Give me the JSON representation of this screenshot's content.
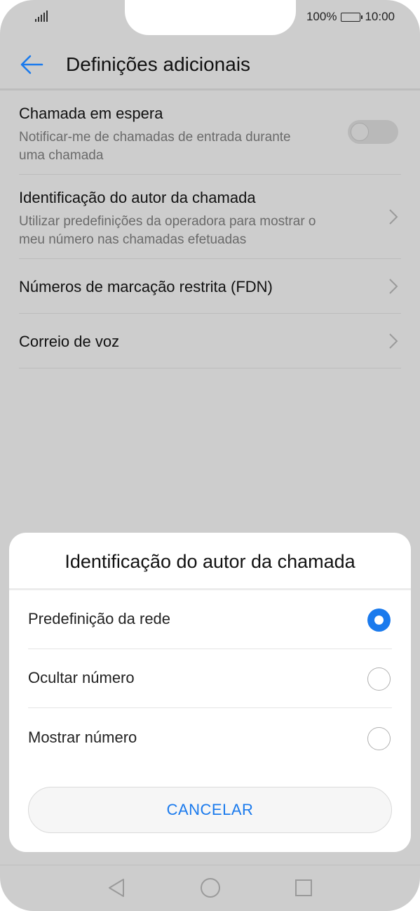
{
  "status_bar": {
    "battery": "100%",
    "time": "10:00"
  },
  "header": {
    "title": "Definições adicionais"
  },
  "settings": [
    {
      "title": "Chamada em espera",
      "subtitle_lines": [
        "Notificar-me de chamadas de entrada durante",
        "uma chamada"
      ],
      "control": "toggle",
      "toggle_on": false
    },
    {
      "title": "Identificação do autor da chamada",
      "subtitle_lines": [
        "Utilizar predefinições da operadora para mostrar o",
        "meu número nas chamadas efetuadas"
      ],
      "control": "chevron"
    },
    {
      "title": "Números de marcação restrita (FDN)",
      "control": "chevron"
    },
    {
      "title": "Correio de voz",
      "control": "chevron"
    }
  ],
  "dialog": {
    "title": "Identificação do autor da chamada",
    "options": [
      {
        "label": "Predefinição da rede",
        "selected": true
      },
      {
        "label": "Ocultar número",
        "selected": false
      },
      {
        "label": "Mostrar número",
        "selected": false
      }
    ],
    "cancel_label": "CANCELAR"
  },
  "nav_bar": {
    "icons": [
      "back-triangle-icon",
      "home-circle-icon",
      "recents-square-icon"
    ]
  },
  "colors": {
    "accent": "#1a7aed",
    "background": "#cdcdcd",
    "dialog": "#ffffff"
  }
}
